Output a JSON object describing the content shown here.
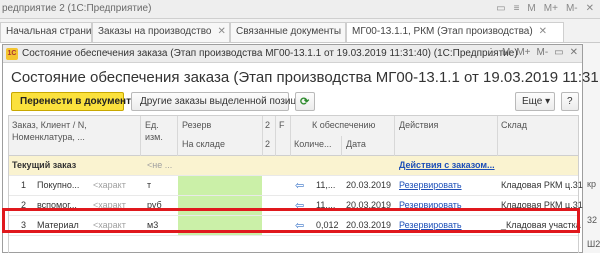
{
  "app": {
    "title": "редприятие 2  (1С:Предприятие)",
    "icons": [
      "▭",
      "≡",
      "M",
      "M+",
      "M-",
      "✕"
    ]
  },
  "tabs": [
    {
      "label": "Начальная страница",
      "close": ""
    },
    {
      "label": "Заказы на производство",
      "close": "✕"
    },
    {
      "label": "Связанные документы",
      "close": "✕"
    },
    {
      "label": "МГ00-13.1.1, РКМ (Этап производства)",
      "close": "✕"
    }
  ],
  "dialog": {
    "icon_text": "1С",
    "title": "Состояние обеспечения заказа (Этап производства МГ00-13.1.1 от 19.03.2019 11:31:40) (1С:Предприятие)",
    "window_icons": [
      "⋮",
      "M",
      "M+",
      "M-",
      "▭",
      "✕"
    ],
    "heading": "Состояние обеспечения заказа (Этап производства МГ00-13.1.1 от 19.03.2019 11:31:40)"
  },
  "toolbar": {
    "transfer_label": "Перенести в документ",
    "other_orders_label": "Другие заказы выделенной позиции",
    "refresh_label": "⟳",
    "more_label": "Еще ▾",
    "help_label": "?"
  },
  "columns": {
    "order": "Заказ, Клиент / N,",
    "order2": "Номенклатура, ...",
    "unit": "Ед.",
    "unit2": "изм.",
    "reserve": "Резерв",
    "warehouse_sub": "На складе",
    "c2": "2",
    "c2b": "2",
    "f": "F",
    "provision": "К обеспечению",
    "qty": "Количе...",
    "date": "Дата",
    "actions": "Действия",
    "stock": "Склад"
  },
  "current_order": {
    "label": "Текущий заказ",
    "unit": "<не ...",
    "actions_link": "Действия с заказом..."
  },
  "rows": [
    {
      "n": "1",
      "name": "Покупно...",
      "char": "<характ",
      "unit": "т",
      "qty": "11,...",
      "date": "20.03.2019",
      "action": "Резервировать",
      "stock": "Кладовая РКМ ц.31"
    },
    {
      "n": "2",
      "name": "вспомог...",
      "char": "<характ",
      "unit": "руб",
      "qty": "11,...",
      "date": "20.03.2019",
      "action": "Резервировать",
      "stock": "Кладовая РКМ ц.31"
    },
    {
      "n": "3",
      "name": "Материал",
      "char": "<характ",
      "unit": "м3",
      "qty": "0,012",
      "date": "20.03.2019",
      "action": "Резервировать",
      "stock": "_Кладовая участка"
    }
  ],
  "background_right": [
    "кр",
    "32",
    "Ш2"
  ],
  "colors": {
    "accent": "#fbe13d",
    "highlight": "#e0181d",
    "reserve_green": "#cbf0a8",
    "link": "#1d4fb8",
    "current_row": "#faf3d0"
  }
}
